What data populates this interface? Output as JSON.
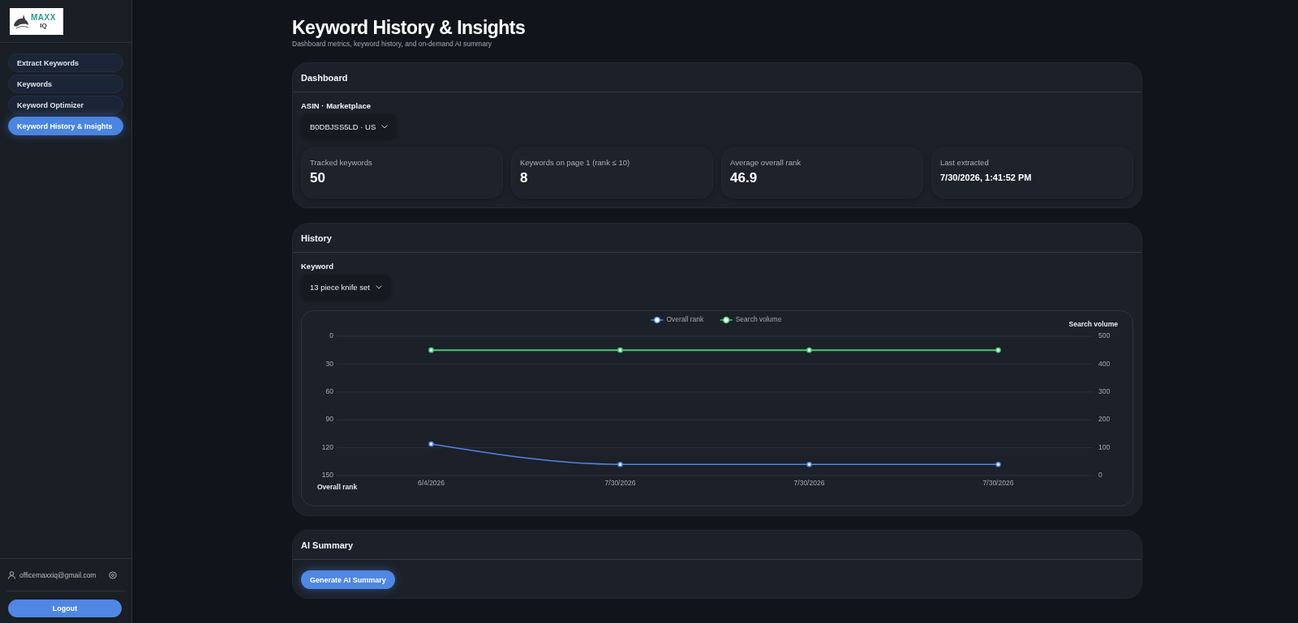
{
  "sidebar": {
    "logo": {
      "text": "MAXX",
      "subtext": "IQ"
    },
    "nav": [
      {
        "label": "Extract Keywords",
        "selected": false
      },
      {
        "label": "Keywords",
        "selected": false
      },
      {
        "label": "Keyword Optimizer",
        "selected": false
      },
      {
        "label": "Keyword History & Insights",
        "selected": true
      }
    ],
    "user": {
      "email": "officemaxxiq@gmail.com"
    },
    "logout": "Logout"
  },
  "page": {
    "title": "Keyword History & Insights",
    "subtitle": "Dashboard metrics, keyword history, and on-demand AI summary"
  },
  "dashboard": {
    "title": "Dashboard",
    "selector": {
      "label": "ASIN · Marketplace",
      "value": "B0DBJSS5LD · US"
    },
    "stats": [
      {
        "label": "Tracked keywords",
        "value": "50",
        "kind": "number"
      },
      {
        "label": "Keywords on page 1 (rank ≤ 10)",
        "value": "8",
        "kind": "number"
      },
      {
        "label": "Average overall rank",
        "value": "46.9",
        "kind": "number"
      },
      {
        "label": "Last extracted",
        "value": "7/30/2026, 1:41:52 PM",
        "kind": "timestamp"
      }
    ]
  },
  "history": {
    "title": "History",
    "selector": {
      "label": "Keyword",
      "value": "13 piece knife set"
    },
    "chart_data": {
      "type": "line",
      "legend": "top",
      "grid": true,
      "categories": [
        "6/4/2026",
        "7/30/2026",
        "7/30/2026",
        "7/30/2026"
      ],
      "ylabel": "Overall rank",
      "ylim": [
        150,
        0
      ],
      "yticks": [
        0,
        30,
        60,
        90,
        120,
        150
      ],
      "y2label": "Search volume",
      "y2lim": [
        0,
        500
      ],
      "y2ticks": [
        0,
        100,
        200,
        300,
        400,
        500
      ],
      "series": [
        {
          "name": "Overall rank",
          "color": "#4f86e0",
          "marker": "circle",
          "values": [
            116,
            138,
            138,
            138
          ]
        },
        {
          "name": "Search volume",
          "color": "#3ecf6e",
          "axis": "y2",
          "marker": "circle",
          "values": [
            450,
            450,
            450,
            450
          ]
        }
      ]
    }
  },
  "ai_summary": {
    "title": "AI Summary",
    "button": "Generate AI Summary"
  }
}
